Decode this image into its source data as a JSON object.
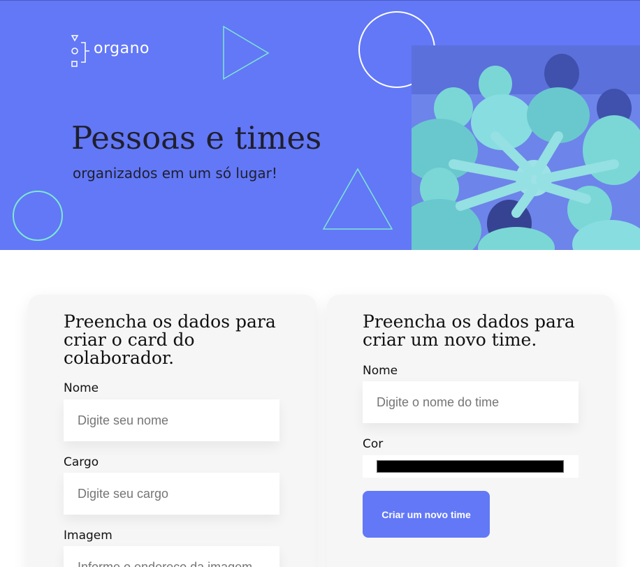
{
  "banner": {
    "logo_text": "organo",
    "title": "Pessoas e times",
    "subtitle": "organizados em um só lugar!",
    "photo_alt": "team-hands-together-photo",
    "colors": {
      "background": "#6278f7",
      "accent": "#7ee8d0"
    }
  },
  "collaborator_form": {
    "heading": "Preencha os dados para criar o card do colaborador.",
    "name_label": "Nome",
    "name_placeholder": "Digite seu nome",
    "role_label": "Cargo",
    "role_placeholder": "Digite seu cargo",
    "image_label": "Imagem",
    "image_placeholder": "Informe o endereço da imagem"
  },
  "team_form": {
    "heading": "Preencha os dados para criar um novo time.",
    "name_label": "Nome",
    "name_placeholder": "Digite o nome do time",
    "color_label": "Cor",
    "color_value": "#000000",
    "submit_label": "Criar um novo time"
  }
}
